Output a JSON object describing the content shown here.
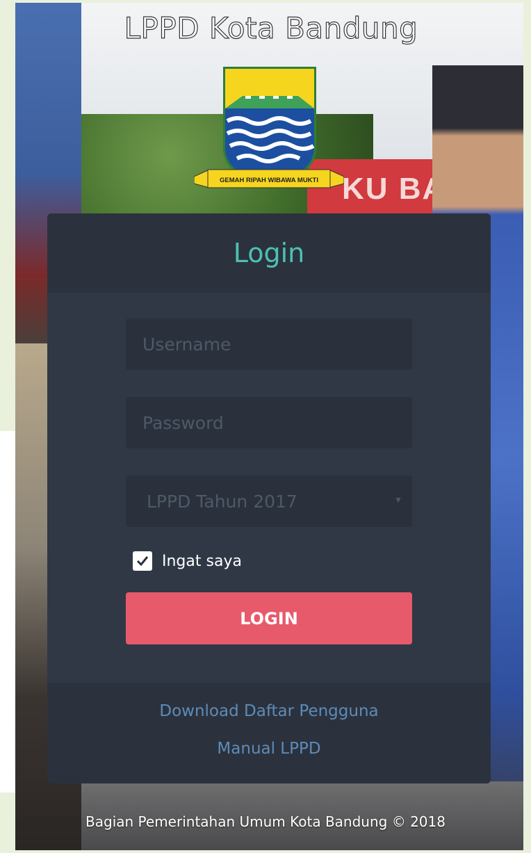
{
  "header": {
    "site_title": "LPPD Kota Bandung",
    "logo_motto": "GEMAH RIPAH WIBAWA MUKTI"
  },
  "background": {
    "banner_text": "KU BAN"
  },
  "login": {
    "title": "Login",
    "username_placeholder": "Username",
    "password_placeholder": "Password",
    "year_select": {
      "selected": "LPPD Tahun 2017"
    },
    "remember_label": "Ingat saya",
    "remember_checked": true,
    "submit_label": "LOGIN"
  },
  "links": {
    "download_users": "Download Daftar Pengguna",
    "manual": "Manual LPPD"
  },
  "footer": {
    "copyright": "Bagian Pemerintahan Umum Kota Bandung © 2018"
  },
  "colors": {
    "panel": "#303845",
    "accent_title": "#4dc0b5",
    "login_button": "#e75a6b",
    "link": "#5e8bb8"
  },
  "icons": [
    "checkmark-icon",
    "caret-down-icon",
    "city-crest-logo"
  ]
}
